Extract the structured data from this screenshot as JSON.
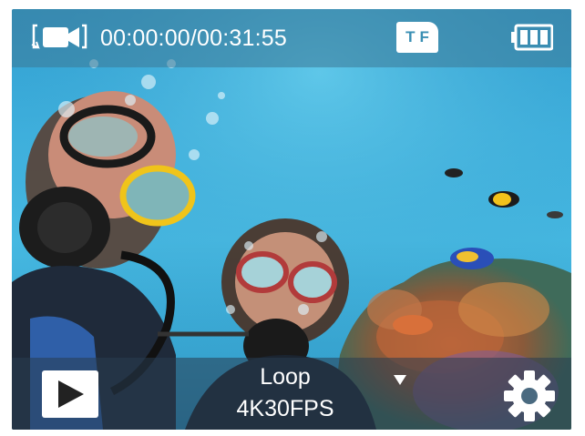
{
  "status_bar": {
    "recording_time": "00:00:00/00:31:55",
    "storage_label": "TF",
    "mode_icon": "loop-video-icon",
    "battery_icon": "battery-full-icon"
  },
  "bottom_bar": {
    "play_icon": "play-icon",
    "mode": "Loop",
    "resolution": "4K30FPS",
    "dropdown_icon": "caret-down-icon",
    "settings_icon": "gear-icon"
  },
  "preview": {
    "description_icon": "camera-preview"
  }
}
